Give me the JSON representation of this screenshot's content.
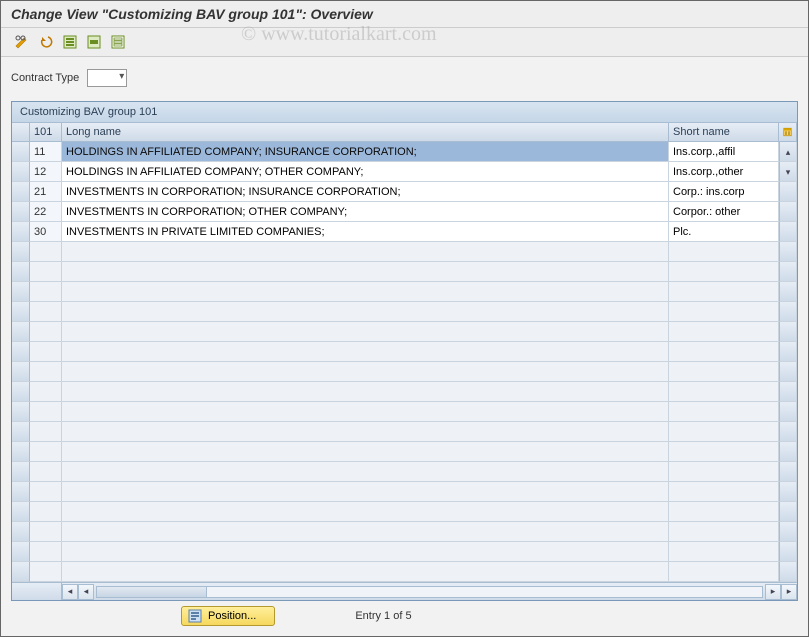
{
  "title": "Change View \"Customizing BAV group 101\": Overview",
  "watermark": "© www.tutorialkart.com",
  "toolbar": {
    "icons": [
      "pencil-toggle",
      "undo",
      "select-all",
      "select-block",
      "deselect"
    ]
  },
  "filter": {
    "label": "Contract Type"
  },
  "table": {
    "title": "Customizing BAV group 101",
    "cols": {
      "id": "101",
      "long": "Long name",
      "short": "Short name"
    },
    "rows": [
      {
        "id": "11",
        "long": "HOLDINGS IN AFFILIATED COMPANY; INSURANCE CORPORATION;",
        "short": "Ins.corp.,affil",
        "selected": true
      },
      {
        "id": "12",
        "long": "HOLDINGS IN AFFILIATED COMPANY; OTHER COMPANY;",
        "short": "Ins.corp.,other",
        "selected": false
      },
      {
        "id": "21",
        "long": "INVESTMENTS IN CORPORATION; INSURANCE CORPORATION;",
        "short": "Corp.: ins.corp",
        "selected": false
      },
      {
        "id": "22",
        "long": "INVESTMENTS IN CORPORATION; OTHER COMPANY;",
        "short": "Corpor.: other",
        "selected": false
      },
      {
        "id": "30",
        "long": "INVESTMENTS IN PRIVATE LIMITED COMPANIES;",
        "short": "Plc.",
        "selected": false
      }
    ],
    "empty_rows": 17
  },
  "footer": {
    "position_label": "Position...",
    "entry_text": "Entry 1 of 5"
  }
}
